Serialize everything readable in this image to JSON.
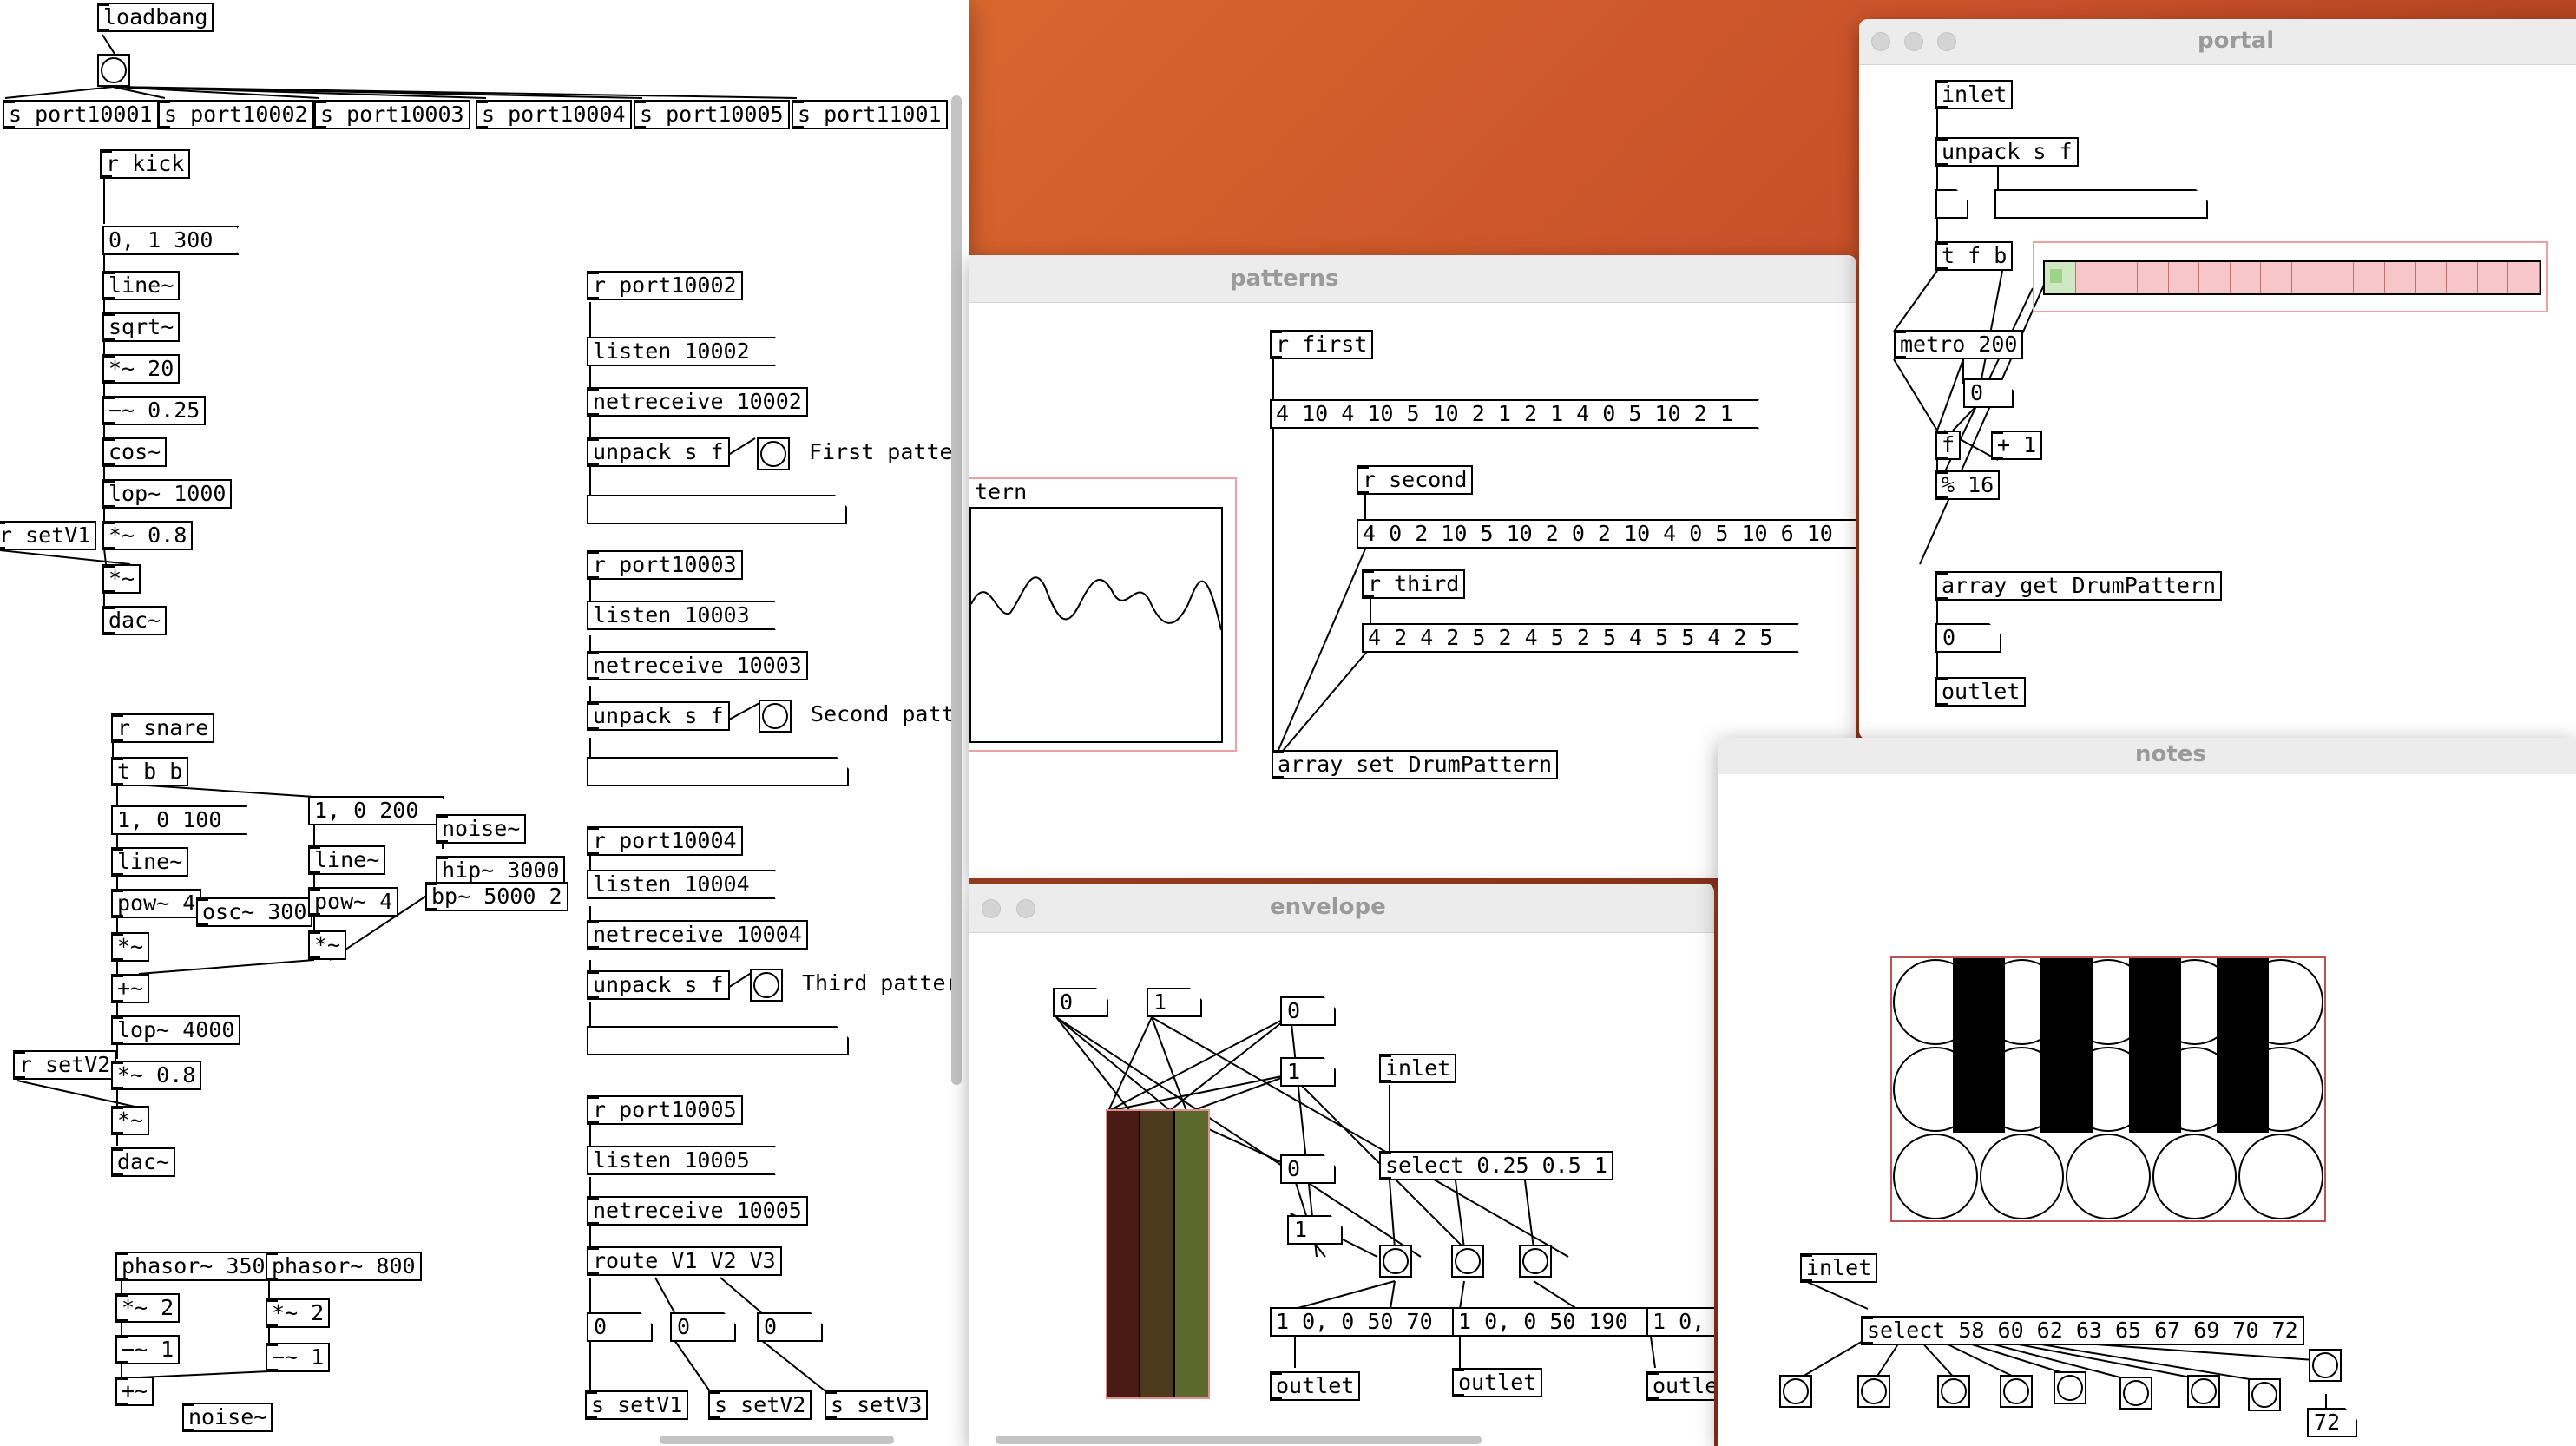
{
  "windows": {
    "main": {
      "objects": {
        "loadbang": "loadbang",
        "s1": "s port10001",
        "s2": "s port10002",
        "s3": "s port10003",
        "s4": "s port10004",
        "s5": "s port10005",
        "s6": "s port11001",
        "rkick": "r kick",
        "m01300": "0, 1 300",
        "line1": "line~",
        "sqrt": "sqrt~",
        "mul20": "*~ 20",
        "minus025": "−~ 0.25",
        "cos": "cos~",
        "lop1000": "lop~ 1000",
        "rsetv1": "r setV1",
        "mul08a": "*~ 0.8",
        "mula": "*~",
        "dac1": "dac~",
        "rsnare": "r snare",
        "tbb": "t b b",
        "m10100": "1, 0 100",
        "m10200": "1, 0 200",
        "noise1": "noise~",
        "line2": "line~",
        "line3": "line~",
        "hip3000": "hip~ 3000",
        "pow4a": "pow~ 4",
        "osc300": "osc~ 300",
        "pow4b": "pow~ 4",
        "bp5000": "bp~ 5000 2",
        "mulb": "*~",
        "mulc": "*~",
        "plus1": "+~",
        "lop4000": "lop~ 4000",
        "rsetv2": "r setV2",
        "mul08b": "*~ 0.8",
        "muld": "*~",
        "dac2": "dac~",
        "phasor350": "phasor~ 350",
        "phasor800": "phasor~ 800",
        "mul2a": "*~ 2",
        "mul2b": "*~ 2",
        "minus1a": "−~ 1",
        "minus1b": "−~ 1",
        "plus2": "+~",
        "noise2": "noise~",
        "rp2": "r port10002",
        "listen2": "listen 10002",
        "netr2": "netreceive 10002",
        "unpack2": "unpack s f",
        "rp3": "r port10003",
        "listen3": "listen 10003",
        "netr3": "netreceive 10003",
        "unpack3": "unpack s f",
        "rp4": "r port10004",
        "listen4": "listen 10004",
        "netr4": "netreceive 10004",
        "unpack4": "unpack s f",
        "rp5": "r port10005",
        "listen5": "listen 10005",
        "netr5": "netreceive 10005",
        "route": "route V1 V2 V3",
        "n0a": "0",
        "n0b": "0",
        "n0c": "0",
        "ssetv1": "s setV1",
        "ssetv2": "s setV2",
        "ssetv3": "s setV3"
      },
      "comments": {
        "first": "First patte",
        "second": "Second patt",
        "third": "Third patter"
      }
    },
    "patterns": {
      "title": "patterns",
      "objects": {
        "rfirst": "r first",
        "msg1": "4 10 4 10 5 10 2 1 2 1 4 0 5 10 2 1",
        "rsecond": "r second",
        "msg2": "4 0 2 10 5 10 2 0 2 10 4 0 5 10 6 10",
        "rthird": "r third",
        "msg3": "4 2 4 2 5 2 4 5 2 5 4 5 5 4 2 5",
        "arrset": "array set DrumPattern"
      },
      "graph_label": "tern"
    },
    "envelope": {
      "title": "envelope",
      "objects": {
        "n0a": "0",
        "n1a": "1",
        "n0b": "0",
        "n1b": "1",
        "n0c": "0",
        "n1c": "1",
        "inlet": "inlet",
        "select": "select 0.25 0.5 1",
        "msg70": "1 0, 0 50 70",
        "msg190": "1 0, 0 50 190",
        "msgcut": "1 0, ",
        "out1": "outlet",
        "out2": "outlet",
        "out3": "outle"
      },
      "slider_colors": [
        "#4a1a14",
        "#4d3a1c",
        "#5b6a2c"
      ]
    },
    "portal": {
      "title": "portal",
      "objects": {
        "inlet": "inlet",
        "unpack": "unpack s f",
        "tfb": "t f b",
        "metro": "metro 200",
        "n0": "0",
        "f": "f",
        "plus1": "+ 1",
        "mod16": "% 16",
        "arrget": "array get DrumPattern",
        "n0b": "0",
        "outlet": "outlet"
      },
      "grid_cells": 16,
      "active_cell": 0
    },
    "notes": {
      "title": "notes",
      "objects": {
        "inlet": "inlet",
        "select": "select 58 60 62 63 65 67 69 70 72",
        "num72": "72"
      }
    }
  }
}
